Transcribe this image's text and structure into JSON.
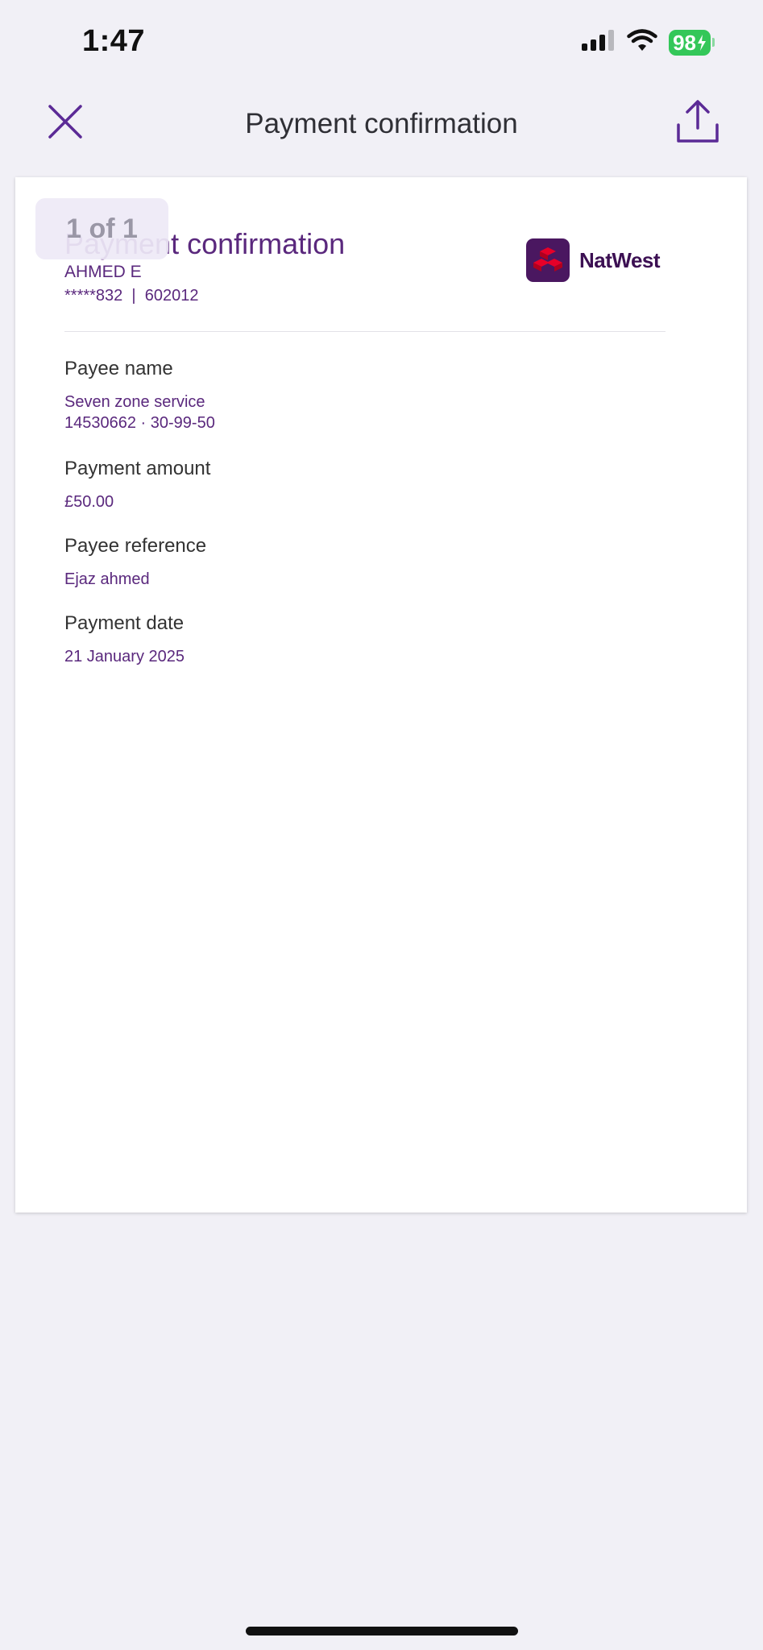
{
  "status_bar": {
    "time": "1:47",
    "battery": "98"
  },
  "nav": {
    "title": "Payment confirmation"
  },
  "document": {
    "page_indicator": "1 of 1",
    "title": "Payment confirmation",
    "account_name": "AHMED E",
    "account_number": "*****832  |  602012",
    "bank_name": "NatWest",
    "fields": [
      {
        "label": "Payee name",
        "values": [
          "Seven zone service",
          "14530662 · 30-99-50"
        ]
      },
      {
        "label": "Payment amount",
        "values": [
          "£50.00"
        ]
      },
      {
        "label": "Payee reference",
        "values": [
          "Ejaz ahmed"
        ]
      },
      {
        "label": "Payment date",
        "values": [
          "21 January 2025"
        ]
      }
    ]
  },
  "colors": {
    "brand_purple": "#5a287d",
    "icon_purple": "#5b2a96",
    "logo_bg": "#4a1760",
    "logo_red": "#e60028",
    "battery_green": "#34c759",
    "page_bg": "#f1f0f6"
  },
  "icons": {
    "close": "close-icon",
    "share": "share-icon",
    "signal": "signal-icon",
    "wifi": "wifi-icon",
    "battery": "battery-icon",
    "bank_logo": "natwest-cubes-icon"
  }
}
